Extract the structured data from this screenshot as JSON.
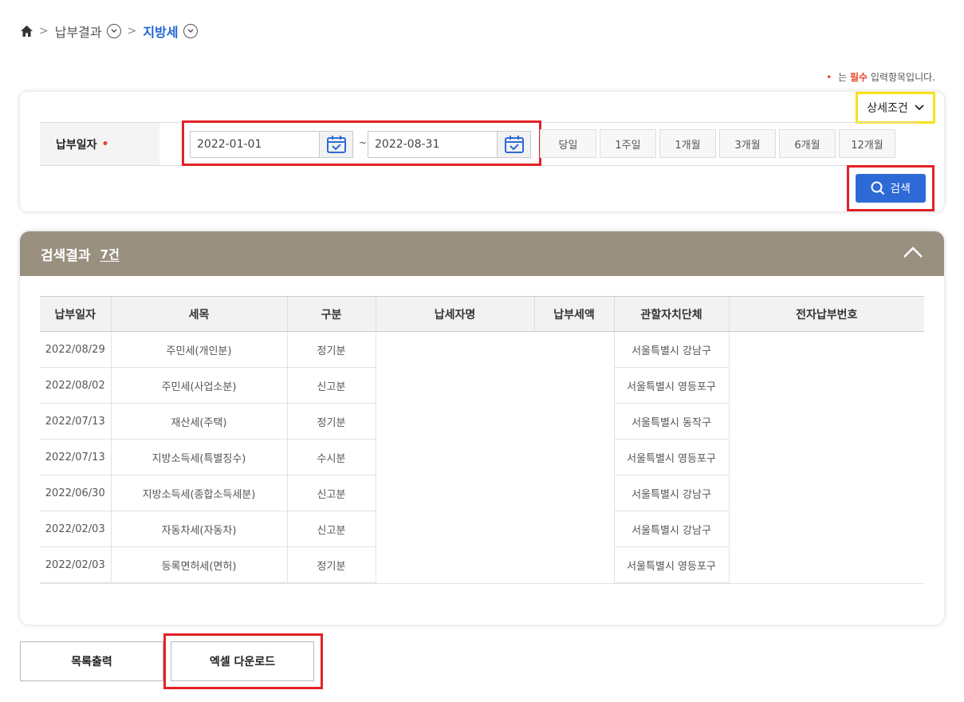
{
  "breadcrumb": {
    "level1": "납부결과",
    "level2": "지방세"
  },
  "required_note": {
    "dot": "•",
    "prefix": "는",
    "strong": "필수",
    "suffix": "입력항목입니다."
  },
  "search": {
    "detail_label": "상세조건",
    "date_label": "납부일자",
    "required_dot": "•",
    "date_from": "2022-01-01",
    "date_to": "2022-08-31",
    "tilde": "~",
    "periods": [
      "당일",
      "1주일",
      "1개월",
      "3개월",
      "6개월",
      "12개월"
    ],
    "search_label": "검색"
  },
  "result": {
    "title": "검색결과",
    "count": "7건",
    "headers": [
      "납부일자",
      "세목",
      "구분",
      "납세자명",
      "납부세액",
      "관할자치단체",
      "전자납부번호"
    ],
    "rows": [
      [
        "2022/08/29",
        "주민세(개인분)",
        "정기분",
        "",
        "",
        "서울특별시 강남구",
        ""
      ],
      [
        "2022/08/02",
        "주민세(사업소분)",
        "신고분",
        "",
        "",
        "서울특별시 영등포구",
        ""
      ],
      [
        "2022/07/13",
        "재산세(주택)",
        "정기분",
        "",
        "",
        "서울특별시 동작구",
        ""
      ],
      [
        "2022/07/13",
        "지방소득세(특별징수)",
        "수시분",
        "",
        "",
        "서울특별시 영등포구",
        ""
      ],
      [
        "2022/06/30",
        "지방소득세(종합소득세분)",
        "신고분",
        "",
        "",
        "서울특별시 강남구",
        ""
      ],
      [
        "2022/02/03",
        "자동차세(자동차)",
        "신고분",
        "",
        "",
        "서울특별시 강남구",
        ""
      ],
      [
        "2022/02/03",
        "등록면허세(면허)",
        "정기분",
        "",
        "",
        "서울특별시 영등포구",
        ""
      ]
    ]
  },
  "buttons": {
    "list_print": "목록출력",
    "excel_download": "엑셀 다운로드"
  },
  "colors": {
    "accent": "#2d6ad6",
    "highlight_red": "#e32127",
    "highlight_yellow": "#f7e11a",
    "result_header": "#9a907f"
  }
}
